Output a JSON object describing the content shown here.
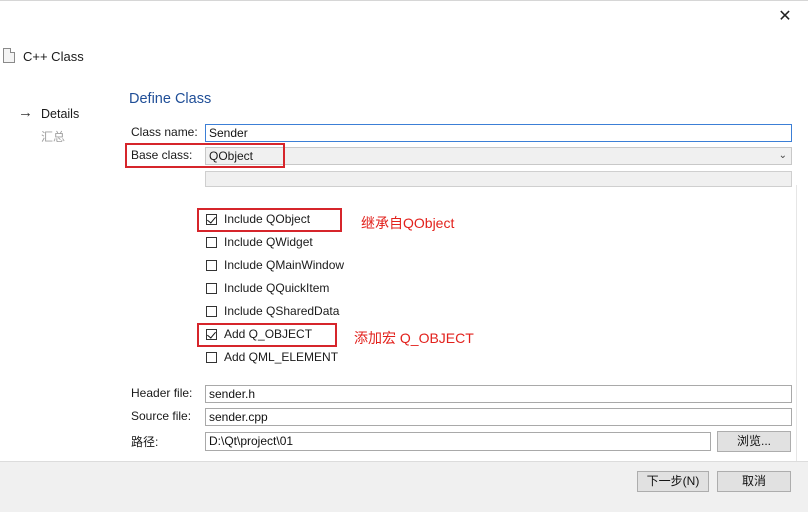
{
  "window": {
    "close_label": "✕",
    "wizard_title": "C++ Class"
  },
  "steps": [
    {
      "label": "Details",
      "active": true
    },
    {
      "label": "汇总",
      "active": false
    }
  ],
  "page": {
    "title": "Define Class",
    "class_name": {
      "label": "Class name:",
      "value": "Sender"
    },
    "base_class": {
      "label": "Base class:",
      "value": "QObject"
    },
    "checkboxes": [
      {
        "label": "Include QObject",
        "checked": true
      },
      {
        "label": "Include QWidget",
        "checked": false
      },
      {
        "label": "Include QMainWindow",
        "checked": false
      },
      {
        "label": "Include QQuickItem",
        "checked": false
      },
      {
        "label": "Include QSharedData",
        "checked": false
      },
      {
        "label": "Add Q_OBJECT",
        "checked": true
      },
      {
        "label": "Add QML_ELEMENT",
        "checked": false
      }
    ],
    "header_file": {
      "label": "Header file:",
      "value": "sender.h"
    },
    "source_file": {
      "label": "Source file:",
      "value": "sender.cpp"
    },
    "path": {
      "label": "路径:",
      "value": "D:\\Qt\\project\\01",
      "browse_label": "浏览..."
    }
  },
  "annotations": {
    "inherit_note": "继承自QObject",
    "macro_note": "添加宏 Q_OBJECT",
    "color": "#e2211c"
  },
  "footer": {
    "next_label": "下一步(N)",
    "cancel_label": "取消"
  },
  "colors": {
    "title_blue": "#1f4e97",
    "focus_blue": "#3c7fd6",
    "highlight_red": "#d6252b"
  }
}
